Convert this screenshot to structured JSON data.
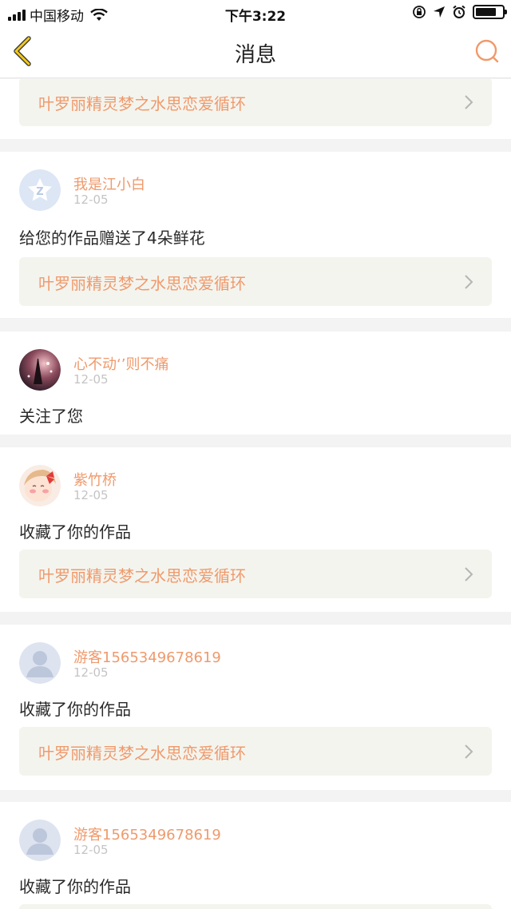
{
  "status_bar": {
    "carrier": "中国移动",
    "time": "下午3:22"
  },
  "nav": {
    "title": "消息"
  },
  "colors": {
    "accent": "#ef9a6c",
    "nav_icon": "#d9b300",
    "date": "#c4c4c4",
    "link_bg": "#f4f4ee"
  },
  "feed": {
    "top_link": {
      "label": "叶罗丽精灵梦之水思恋爱循环"
    },
    "items": [
      {
        "username": "我是江小白",
        "date": "12-05",
        "message": "给您的作品赠送了4朵鲜花",
        "link": "叶罗丽精灵梦之水思恋爱循环"
      },
      {
        "username": "心不动‘’则不痛",
        "date": "12-05",
        "message": "关注了您"
      },
      {
        "username": "紫竹桥",
        "date": "12-05",
        "message": "收藏了你的作品",
        "link": "叶罗丽精灵梦之水思恋爱循环"
      },
      {
        "username": "游客1565349678619",
        "date": "12-05",
        "message": "收藏了你的作品",
        "link": "叶罗丽精灵梦之水思恋爱循环"
      },
      {
        "username": "游客1565349678619",
        "date": "12-05",
        "message": "收藏了你的作品"
      }
    ]
  }
}
